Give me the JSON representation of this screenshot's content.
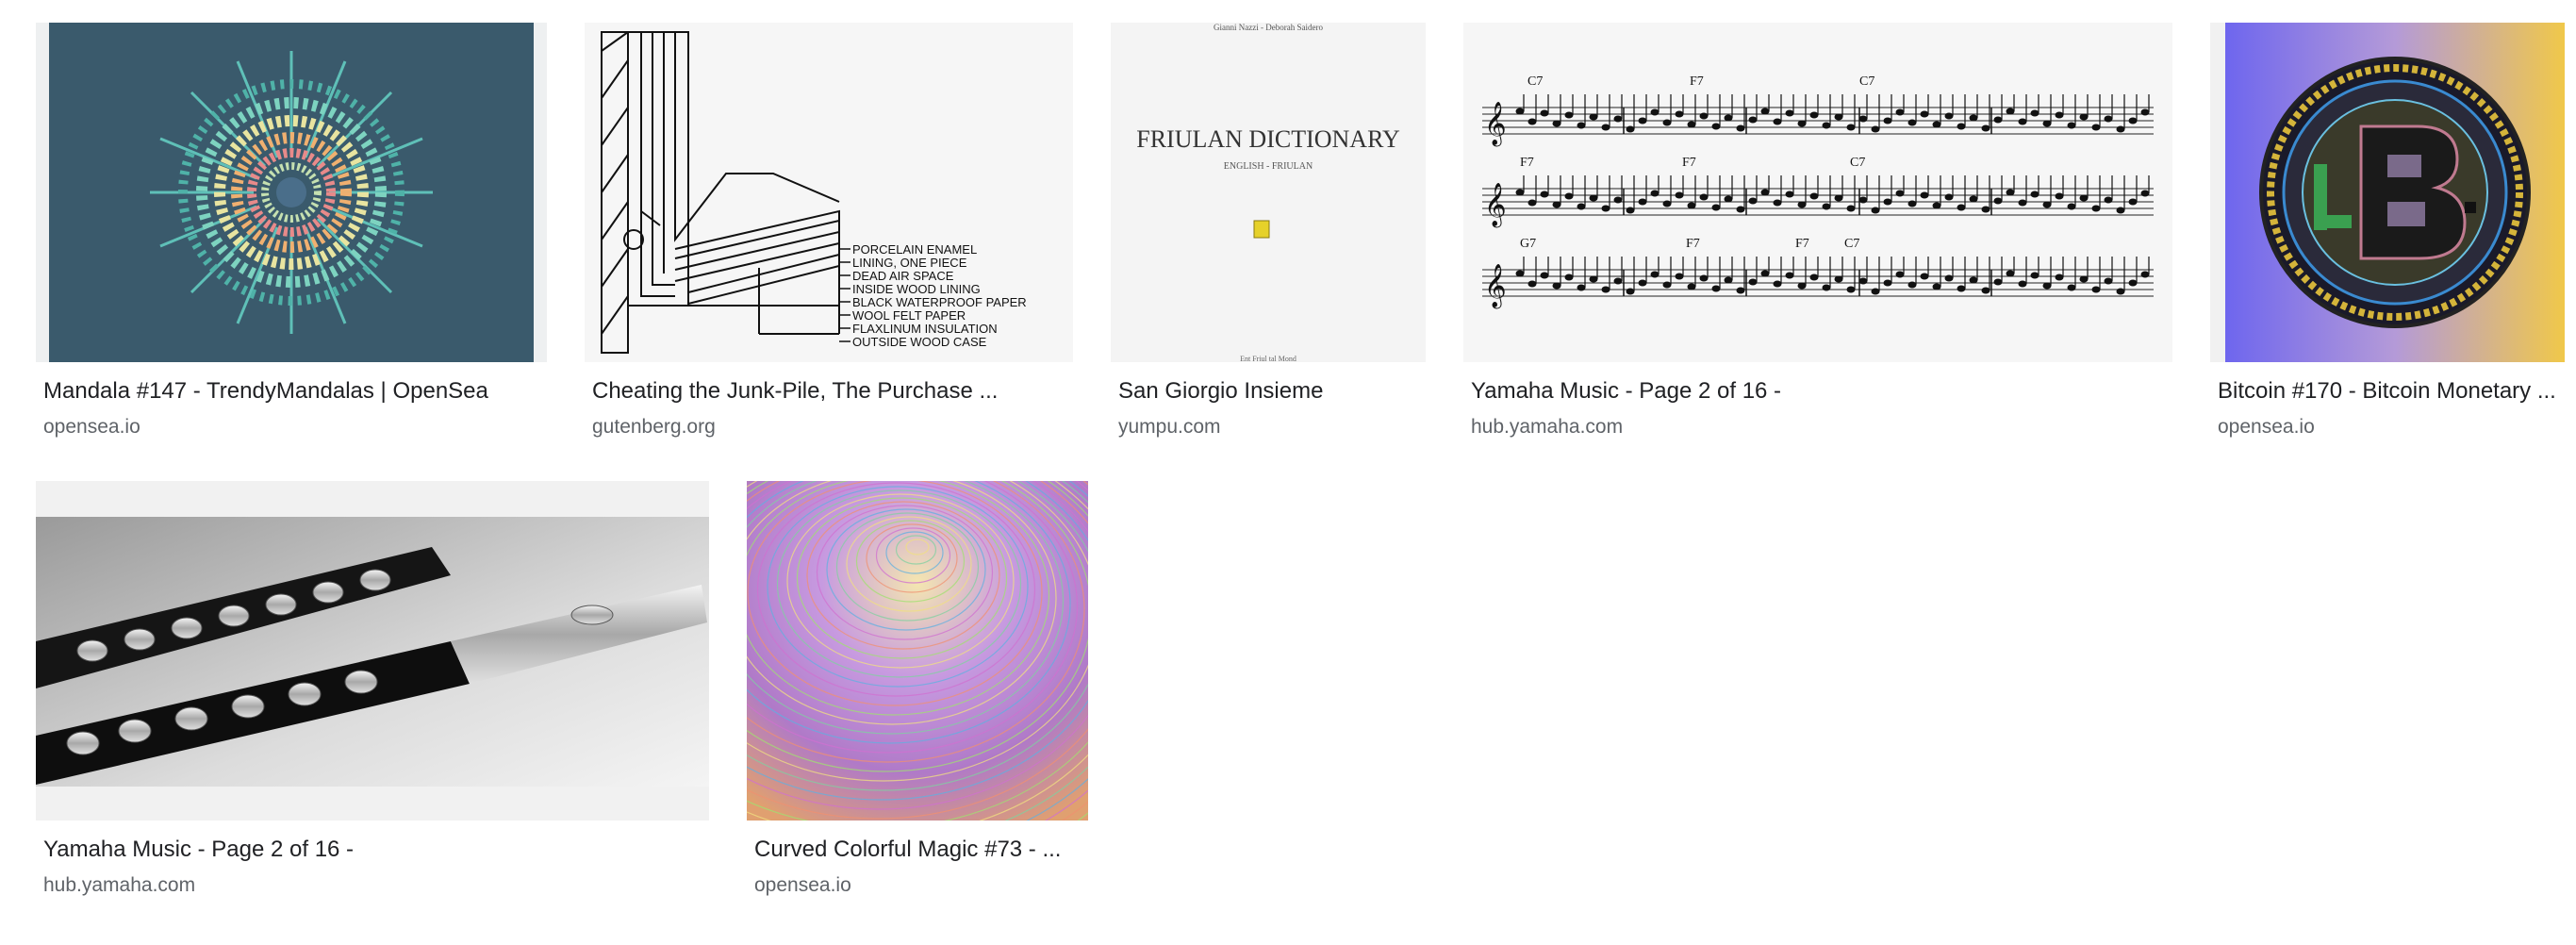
{
  "results": [
    {
      "title": "Mandala #147 - TrendyMandalas | OpenSea",
      "source": "opensea.io",
      "image": "mandala-image"
    },
    {
      "title": "Cheating the Junk-Pile, The Purchase ...",
      "source": "gutenberg.org",
      "image": "cross-section-diagram-image",
      "labels": [
        "PORCELAIN ENAMEL",
        "LINING, ONE PIECE",
        "DEAD AIR SPACE",
        "INSIDE WOOD LINING",
        "BLACK WATERPROOF PAPER",
        "WOOL FELT PAPER",
        "FLAXLINUM INSULATION",
        "OUTSIDE WOOD CASE"
      ]
    },
    {
      "title": "San Giorgio Insieme",
      "source": "yumpu.com",
      "image": "book-cover-image",
      "cover": {
        "authors": "Gianni Nazzi - Deborah Saidero",
        "heading": "FRIULAN DICTIONARY",
        "subheading": "ENGLISH - FRIULAN",
        "footer": "Ent Friul tal Mond"
      }
    },
    {
      "title": "Yamaha Music - Page 2 of 16 -",
      "source": "hub.yamaha.com",
      "image": "sheet-music-image",
      "chords": [
        [
          "C7",
          "F7",
          "C7"
        ],
        [
          "F7",
          "F7",
          "C7"
        ],
        [
          "G7",
          "F7",
          "F7",
          "C7"
        ]
      ]
    },
    {
      "title": "Bitcoin #170 - Bitcoin Monetary ...",
      "source": "opensea.io",
      "image": "bitcoin-coin-image"
    },
    {
      "title": "Yamaha Music - Page 2 of 16 -",
      "source": "hub.yamaha.com",
      "image": "flute-photo-image"
    },
    {
      "title": "Curved Colorful Magic #73 - ...",
      "source": "opensea.io",
      "image": "colorful-curves-image"
    }
  ],
  "colors": {
    "mandala_bg": "#3a5a6c",
    "bitcoin_gold": "#e9c84a",
    "bitcoin_violet": "#7a6cf0",
    "title_text": "#202124",
    "source_text": "#5f6368"
  }
}
